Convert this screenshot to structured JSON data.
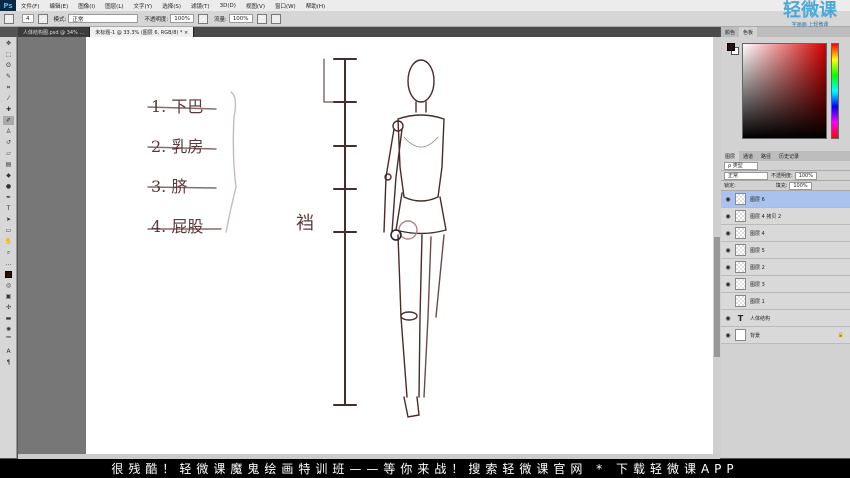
{
  "app": {
    "logo": "Ps"
  },
  "menu": [
    "文件(F)",
    "编辑(E)",
    "图像(I)",
    "图层(L)",
    "文字(Y)",
    "选择(S)",
    "滤镜(T)",
    "3D(D)",
    "视图(V)",
    "窗口(W)",
    "帮助(H)"
  ],
  "options": {
    "brush_size": "4",
    "mode_label": "模式:",
    "mode_value": "正常",
    "opacity_label": "不透明度:",
    "opacity_value": "100%",
    "flow_label": "流量:",
    "flow_value": "100%"
  },
  "document_tabs": [
    {
      "label": "人体结构图.psd @ 34% ..."
    },
    {
      "label": "未标题-1 @ 33.3% (图层 6, RGB/8) * ×"
    }
  ],
  "canvas_sketch": {
    "list": [
      "1. 下巴",
      "2. 乳房",
      "3. 脐",
      "4. 屁股"
    ],
    "side_label": "裆"
  },
  "panel_tabs_top": [
    "颜色",
    "色板"
  ],
  "panel_tabs_layers": [
    "图层",
    "通道",
    "路径",
    "历史记录"
  ],
  "layers_panel": {
    "filter_label": "ρ 类型",
    "blend_mode": "正常",
    "opacity_label": "不透明度:",
    "opacity_value": "100%",
    "lock_label": "锁定:",
    "fill_label": "填充:",
    "fill_value": "100%",
    "layers": [
      {
        "name": "图层 6",
        "type": "raster",
        "selected": true,
        "visible": true
      },
      {
        "name": "图层 4 拷贝 2",
        "type": "raster",
        "selected": false,
        "visible": true
      },
      {
        "name": "图层 4",
        "type": "raster",
        "selected": false,
        "visible": true
      },
      {
        "name": "图层 5",
        "type": "raster",
        "selected": false,
        "visible": true
      },
      {
        "name": "图层 2",
        "type": "raster",
        "selected": false,
        "visible": true
      },
      {
        "name": "图层 3",
        "type": "raster",
        "selected": false,
        "visible": true
      },
      {
        "name": "图层 1",
        "type": "raster",
        "selected": false,
        "visible": false
      },
      {
        "name": "人体结构",
        "type": "text",
        "selected": false,
        "visible": true
      },
      {
        "name": "背景",
        "type": "background",
        "selected": false,
        "visible": true
      }
    ]
  },
  "watermark": {
    "title": "轻微课",
    "sub": "字画画 上轻微课"
  },
  "banner_text": "很残酷！轻微课魔鬼绘画特训班——等你来战！搜索轻微课官网 * 下载轻微课APP",
  "colors": {
    "foreground": "#2a0f0f",
    "selected_layer": "#a9c3ee",
    "sketch_stroke": "#4a2b2b"
  }
}
